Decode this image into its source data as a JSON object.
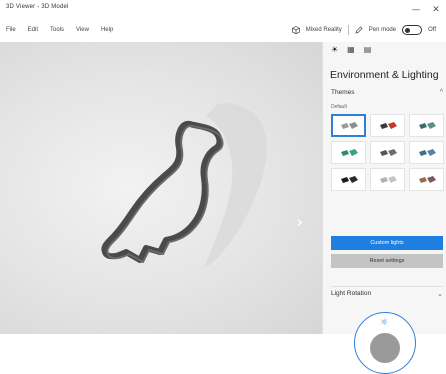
{
  "window": {
    "title": "3D Viewer - 3D Model",
    "minimize_glyph": "—",
    "close_glyph": "✕"
  },
  "menubar": {
    "items": [
      "File",
      "Edit",
      "Tools",
      "View",
      "Help"
    ],
    "right": {
      "mixed_reality": "Mixed Reality",
      "mixed_reality_icon": "cube-icon",
      "pen_mode": "Pen mode",
      "pen_icon": "pen-icon",
      "toggle_state": "Off"
    }
  },
  "viewport": {
    "background_color": "#e6e6e6",
    "model_color": "#555555",
    "next_arrow": "›"
  },
  "panel": {
    "tabs": [
      {
        "icon": "environment-icon",
        "glyph": "☀"
      },
      {
        "icon": "stats-icon",
        "glyph": "▦"
      },
      {
        "icon": "animation-icon",
        "glyph": "▤"
      }
    ],
    "title": "Environment & Lighting",
    "themes": {
      "label": "Themes",
      "subheading": "Default",
      "collapse_glyph": "^",
      "tiles": [
        {
          "name": "theme-1",
          "colors": [
            "#9a9a9a",
            "#8f8f8f"
          ],
          "selected": true
        },
        {
          "name": "theme-2",
          "colors": [
            "#3a3a3a",
            "#c0392b"
          ]
        },
        {
          "name": "theme-3",
          "colors": [
            "#3a6d6a",
            "#5a8f8a"
          ]
        },
        {
          "name": "theme-4",
          "colors": [
            "#2e8b6b",
            "#3fa37f"
          ]
        },
        {
          "name": "theme-5",
          "colors": [
            "#555555",
            "#6d6d6d"
          ]
        },
        {
          "name": "theme-6",
          "colors": [
            "#3f6f8a",
            "#5584a0"
          ]
        },
        {
          "name": "theme-7",
          "colors": [
            "#1a1a1a",
            "#2a2a2a"
          ]
        },
        {
          "name": "theme-8",
          "colors": [
            "#b0b0b0",
            "#c4c4c4"
          ]
        },
        {
          "name": "theme-9",
          "colors": [
            "#9a6a4a",
            "#7a5a5a"
          ]
        }
      ]
    },
    "custom_button": "Custom lights",
    "reset_button": "Reset settings",
    "light_rotation": {
      "label": "Light Rotation",
      "expand_glyph": "⌄",
      "sun_glyph": "☼"
    },
    "accent_color": "#1f7fe0"
  }
}
